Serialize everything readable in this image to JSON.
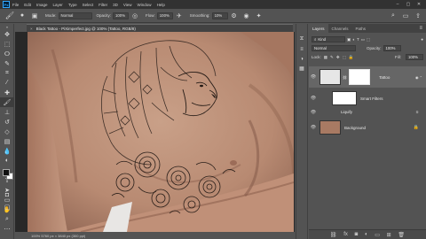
{
  "menubar": {
    "logo": "Ps",
    "items": [
      "File",
      "Edit",
      "Image",
      "Layer",
      "Type",
      "Select",
      "Filter",
      "3D",
      "View",
      "Window",
      "Help"
    ],
    "controls": [
      "–",
      "▢",
      "✕"
    ]
  },
  "options": {
    "mode_label": "Mode:",
    "mode_value": "Normal",
    "opacity_label": "Opacity:",
    "opacity_value": "100%",
    "flow_label": "Flow:",
    "flow_value": "100%",
    "smoothing_label": "Smoothing:",
    "smoothing_value": "10%"
  },
  "document": {
    "tab_title": "Black Tattoo - PiXimperfect.jpg @ 100% (Tattoo, RGB/8)",
    "tab_close": "×",
    "status": "100%    5760 px × 3840 px (300 ppi)"
  },
  "layers_panel": {
    "tabs": [
      "Layers",
      "Channels",
      "Paths"
    ],
    "kind_label": "Kind",
    "blend_mode": "Normal",
    "opacity_label": "Opacity:",
    "opacity_value": "100%",
    "lock_label": "Lock:",
    "fill_label": "Fill:",
    "fill_value": "100%",
    "layers": [
      {
        "name": "Tattoo",
        "selected": true
      },
      {
        "name": "Smart Filters"
      },
      {
        "name": "Liquify"
      },
      {
        "name": "Background"
      }
    ]
  },
  "colors": {
    "accent": "#31a8ff",
    "selected_layer": "#666666"
  }
}
